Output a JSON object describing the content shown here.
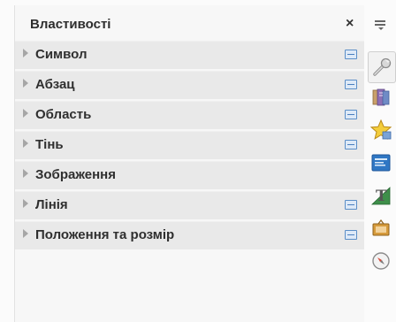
{
  "panel": {
    "title": "Властивості",
    "close_glyph": "×"
  },
  "sections": [
    {
      "label": "Символ",
      "has_more_options": true
    },
    {
      "label": "Абзац",
      "has_more_options": true
    },
    {
      "label": "Область",
      "has_more_options": true
    },
    {
      "label": "Тінь",
      "has_more_options": true
    },
    {
      "label": "Зображення",
      "has_more_options": false
    },
    {
      "label": "Лінія",
      "has_more_options": true
    },
    {
      "label": "Положення та розмір",
      "has_more_options": true
    }
  ],
  "sidebar": {
    "menu_icon": "sidebar-settings-menu-icon",
    "decks": [
      {
        "icon": "properties-wrench-icon",
        "active": true
      },
      {
        "icon": "styles-icon",
        "active": false
      },
      {
        "icon": "gallery-star-icon",
        "active": false
      },
      {
        "icon": "slide-layouts-icon",
        "active": false
      },
      {
        "icon": "custom-animation-icon",
        "active": false
      },
      {
        "icon": "slide-transition-icon",
        "active": false
      },
      {
        "icon": "navigator-compass-icon",
        "active": false
      }
    ]
  },
  "colors": {
    "more_options_blue": "#5b8ec7",
    "section_bg": "#e9e9e9",
    "panel_bg": "#f7f7f7"
  }
}
